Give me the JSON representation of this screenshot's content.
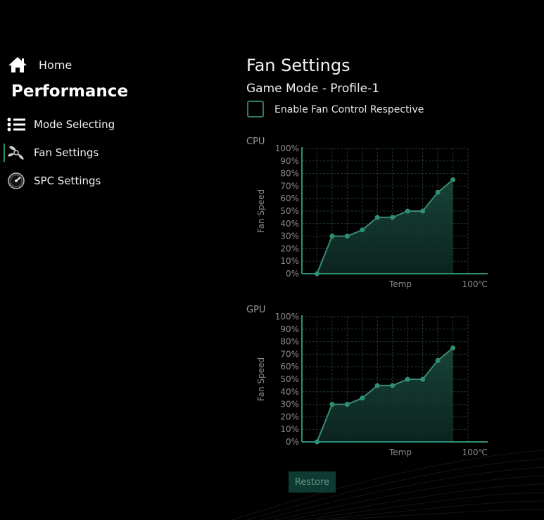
{
  "sidebar": {
    "home_label": "Home",
    "section_title": "Performance",
    "items": [
      {
        "label": "Mode Selecting",
        "icon": "list-icon"
      },
      {
        "label": "Fan Settings",
        "icon": "fan-icon"
      },
      {
        "label": "SPC Settings",
        "icon": "gauge-icon"
      }
    ],
    "active_item": "Fan Settings"
  },
  "main": {
    "title": "Fan Settings",
    "subtitle": "Game Mode - Profile-1",
    "checkbox_label": "Enable Fan Control Respective",
    "checkbox_checked": false,
    "restore_label": "Restore"
  },
  "colors": {
    "accent": "#2f8f76",
    "line": "#3a8a74",
    "fill": "#12352d",
    "grid": "#1e3a33",
    "axis_text": "#8a8a8a"
  },
  "chart_data": [
    {
      "type": "line",
      "title": "CPU",
      "xlabel": "Temp",
      "ylabel": "Fan Speed",
      "x_end_label": "100℃",
      "y_ticks": [
        "100%",
        "90%",
        "80%",
        "70%",
        "60%",
        "50%",
        "40%",
        "30%",
        "20%",
        "10%",
        "0%"
      ],
      "ylim": [
        0,
        100
      ],
      "x": [
        1,
        2,
        3,
        4,
        5,
        6,
        7,
        8,
        9,
        10
      ],
      "values": [
        0,
        30,
        30,
        35,
        45,
        45,
        50,
        50,
        65,
        75
      ]
    },
    {
      "type": "line",
      "title": "GPU",
      "xlabel": "Temp",
      "ylabel": "Fan Speed",
      "x_end_label": "100℃",
      "y_ticks": [
        "100%",
        "90%",
        "80%",
        "70%",
        "60%",
        "50%",
        "40%",
        "30%",
        "20%",
        "10%",
        "0%"
      ],
      "ylim": [
        0,
        100
      ],
      "x": [
        1,
        2,
        3,
        4,
        5,
        6,
        7,
        8,
        9,
        10
      ],
      "values": [
        0,
        30,
        30,
        35,
        45,
        45,
        50,
        50,
        65,
        75
      ]
    }
  ]
}
